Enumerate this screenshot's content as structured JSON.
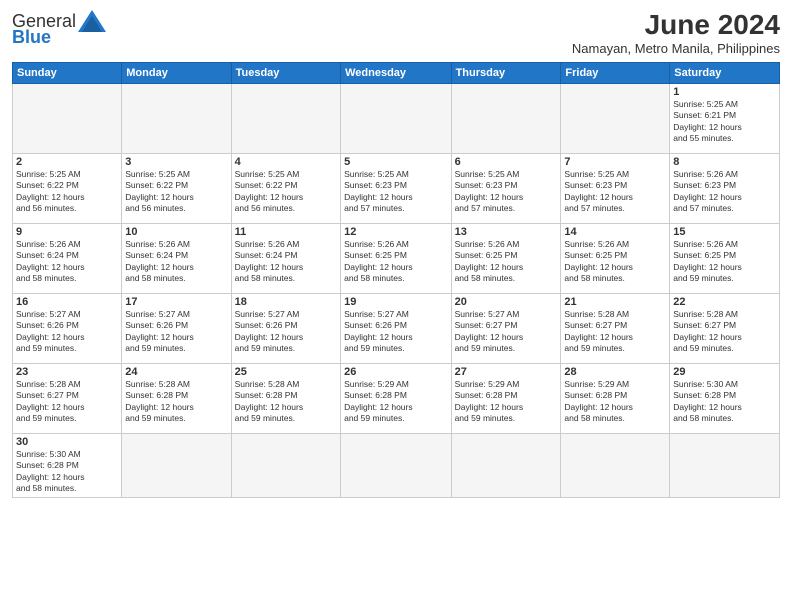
{
  "logo": {
    "text_general": "General",
    "text_blue": "Blue"
  },
  "header": {
    "month_year": "June 2024",
    "location": "Namayan, Metro Manila, Philippines"
  },
  "weekdays": [
    "Sunday",
    "Monday",
    "Tuesday",
    "Wednesday",
    "Thursday",
    "Friday",
    "Saturday"
  ],
  "weeks": [
    [
      null,
      null,
      null,
      null,
      null,
      null,
      {
        "day": "1",
        "sunrise": "5:25 AM",
        "sunset": "6:21 PM",
        "daylight": "12 hours and 55 minutes."
      }
    ],
    [
      {
        "day": "2",
        "sunrise": "5:25 AM",
        "sunset": "6:22 PM",
        "daylight": "12 hours and 56 minutes."
      },
      {
        "day": "3",
        "sunrise": "5:25 AM",
        "sunset": "6:22 PM",
        "daylight": "12 hours and 56 minutes."
      },
      {
        "day": "4",
        "sunrise": "5:25 AM",
        "sunset": "6:22 PM",
        "daylight": "12 hours and 56 minutes."
      },
      {
        "day": "5",
        "sunrise": "5:25 AM",
        "sunset": "6:23 PM",
        "daylight": "12 hours and 57 minutes."
      },
      {
        "day": "6",
        "sunrise": "5:25 AM",
        "sunset": "6:23 PM",
        "daylight": "12 hours and 57 minutes."
      },
      {
        "day": "7",
        "sunrise": "5:25 AM",
        "sunset": "6:23 PM",
        "daylight": "12 hours and 57 minutes."
      },
      {
        "day": "8",
        "sunrise": "5:26 AM",
        "sunset": "6:23 PM",
        "daylight": "12 hours and 57 minutes."
      }
    ],
    [
      {
        "day": "9",
        "sunrise": "5:26 AM",
        "sunset": "6:24 PM",
        "daylight": "12 hours and 58 minutes."
      },
      {
        "day": "10",
        "sunrise": "5:26 AM",
        "sunset": "6:24 PM",
        "daylight": "12 hours and 58 minutes."
      },
      {
        "day": "11",
        "sunrise": "5:26 AM",
        "sunset": "6:24 PM",
        "daylight": "12 hours and 58 minutes."
      },
      {
        "day": "12",
        "sunrise": "5:26 AM",
        "sunset": "6:25 PM",
        "daylight": "12 hours and 58 minutes."
      },
      {
        "day": "13",
        "sunrise": "5:26 AM",
        "sunset": "6:25 PM",
        "daylight": "12 hours and 58 minutes."
      },
      {
        "day": "14",
        "sunrise": "5:26 AM",
        "sunset": "6:25 PM",
        "daylight": "12 hours and 58 minutes."
      },
      {
        "day": "15",
        "sunrise": "5:26 AM",
        "sunset": "6:25 PM",
        "daylight": "12 hours and 59 minutes."
      }
    ],
    [
      {
        "day": "16",
        "sunrise": "5:27 AM",
        "sunset": "6:26 PM",
        "daylight": "12 hours and 59 minutes."
      },
      {
        "day": "17",
        "sunrise": "5:27 AM",
        "sunset": "6:26 PM",
        "daylight": "12 hours and 59 minutes."
      },
      {
        "day": "18",
        "sunrise": "5:27 AM",
        "sunset": "6:26 PM",
        "daylight": "12 hours and 59 minutes."
      },
      {
        "day": "19",
        "sunrise": "5:27 AM",
        "sunset": "6:26 PM",
        "daylight": "12 hours and 59 minutes."
      },
      {
        "day": "20",
        "sunrise": "5:27 AM",
        "sunset": "6:27 PM",
        "daylight": "12 hours and 59 minutes."
      },
      {
        "day": "21",
        "sunrise": "5:28 AM",
        "sunset": "6:27 PM",
        "daylight": "12 hours and 59 minutes."
      },
      {
        "day": "22",
        "sunrise": "5:28 AM",
        "sunset": "6:27 PM",
        "daylight": "12 hours and 59 minutes."
      }
    ],
    [
      {
        "day": "23",
        "sunrise": "5:28 AM",
        "sunset": "6:27 PM",
        "daylight": "12 hours and 59 minutes."
      },
      {
        "day": "24",
        "sunrise": "5:28 AM",
        "sunset": "6:28 PM",
        "daylight": "12 hours and 59 minutes."
      },
      {
        "day": "25",
        "sunrise": "5:28 AM",
        "sunset": "6:28 PM",
        "daylight": "12 hours and 59 minutes."
      },
      {
        "day": "26",
        "sunrise": "5:29 AM",
        "sunset": "6:28 PM",
        "daylight": "12 hours and 59 minutes."
      },
      {
        "day": "27",
        "sunrise": "5:29 AM",
        "sunset": "6:28 PM",
        "daylight": "12 hours and 59 minutes."
      },
      {
        "day": "28",
        "sunrise": "5:29 AM",
        "sunset": "6:28 PM",
        "daylight": "12 hours and 58 minutes."
      },
      {
        "day": "29",
        "sunrise": "5:30 AM",
        "sunset": "6:28 PM",
        "daylight": "12 hours and 58 minutes."
      }
    ],
    [
      {
        "day": "30",
        "sunrise": "5:30 AM",
        "sunset": "6:28 PM",
        "daylight": "12 hours and 58 minutes."
      },
      null,
      null,
      null,
      null,
      null,
      null
    ]
  ],
  "labels": {
    "sunrise": "Sunrise:",
    "sunset": "Sunset:",
    "daylight": "Daylight:"
  }
}
